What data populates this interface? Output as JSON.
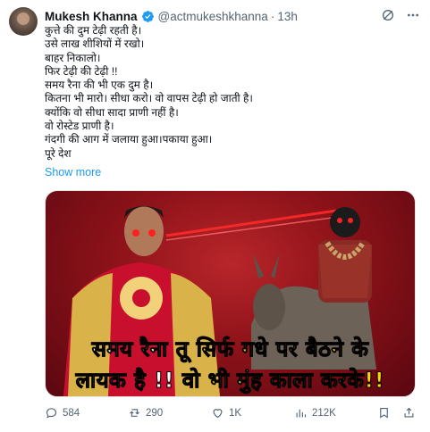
{
  "tweet": {
    "author_name": "Mukesh Khanna",
    "handle": "@actmukeshkhanna",
    "separator": "·",
    "time": "13h",
    "lines": [
      "कुत्ते की दुम टेढ़ी रहती है।",
      "उसे लाख शीशियों में रखो।",
      "बाहर निकालो।",
      "फिर टेढ़ी की टेढ़ी !!",
      "समय रैना की भी एक दुम है।",
      "कितना भी मारो। सीधा करो। वो वापस टेढ़ी हो जाती है।",
      "क्योंकि वो सीधा सादा प्राणी नहीं है।",
      "वो रोस्टेड प्राणी है।",
      "गंदगी की आग में जलाया हुआ।पकाया हुआ।",
      "पूरे देश"
    ],
    "show_more": "Show more"
  },
  "media": {
    "caption_line1_white": "समय रैना तू ",
    "caption_line1_yellow": "सिर्फ गधे पर बैठने के",
    "caption_line2_white": "लायक है !! ",
    "caption_line2_yellow": "वो भी मुंह काला करके!!"
  },
  "actions": {
    "replies": "584",
    "reposts": "290",
    "likes": "1K",
    "views": "212K"
  },
  "icons": {
    "verified": "verified-badge-icon",
    "grok": "grok-icon",
    "more": "more-icon",
    "reply": "reply-icon",
    "repost": "repost-icon",
    "like": "like-icon",
    "views": "views-icon",
    "bookmark": "bookmark-icon",
    "share": "share-icon"
  },
  "colors": {
    "link": "#1d9bf0",
    "muted": "#536471",
    "repost_active": "#00ba7c",
    "image_background": "#8d1219",
    "caption_yellow": "#ffd400"
  }
}
